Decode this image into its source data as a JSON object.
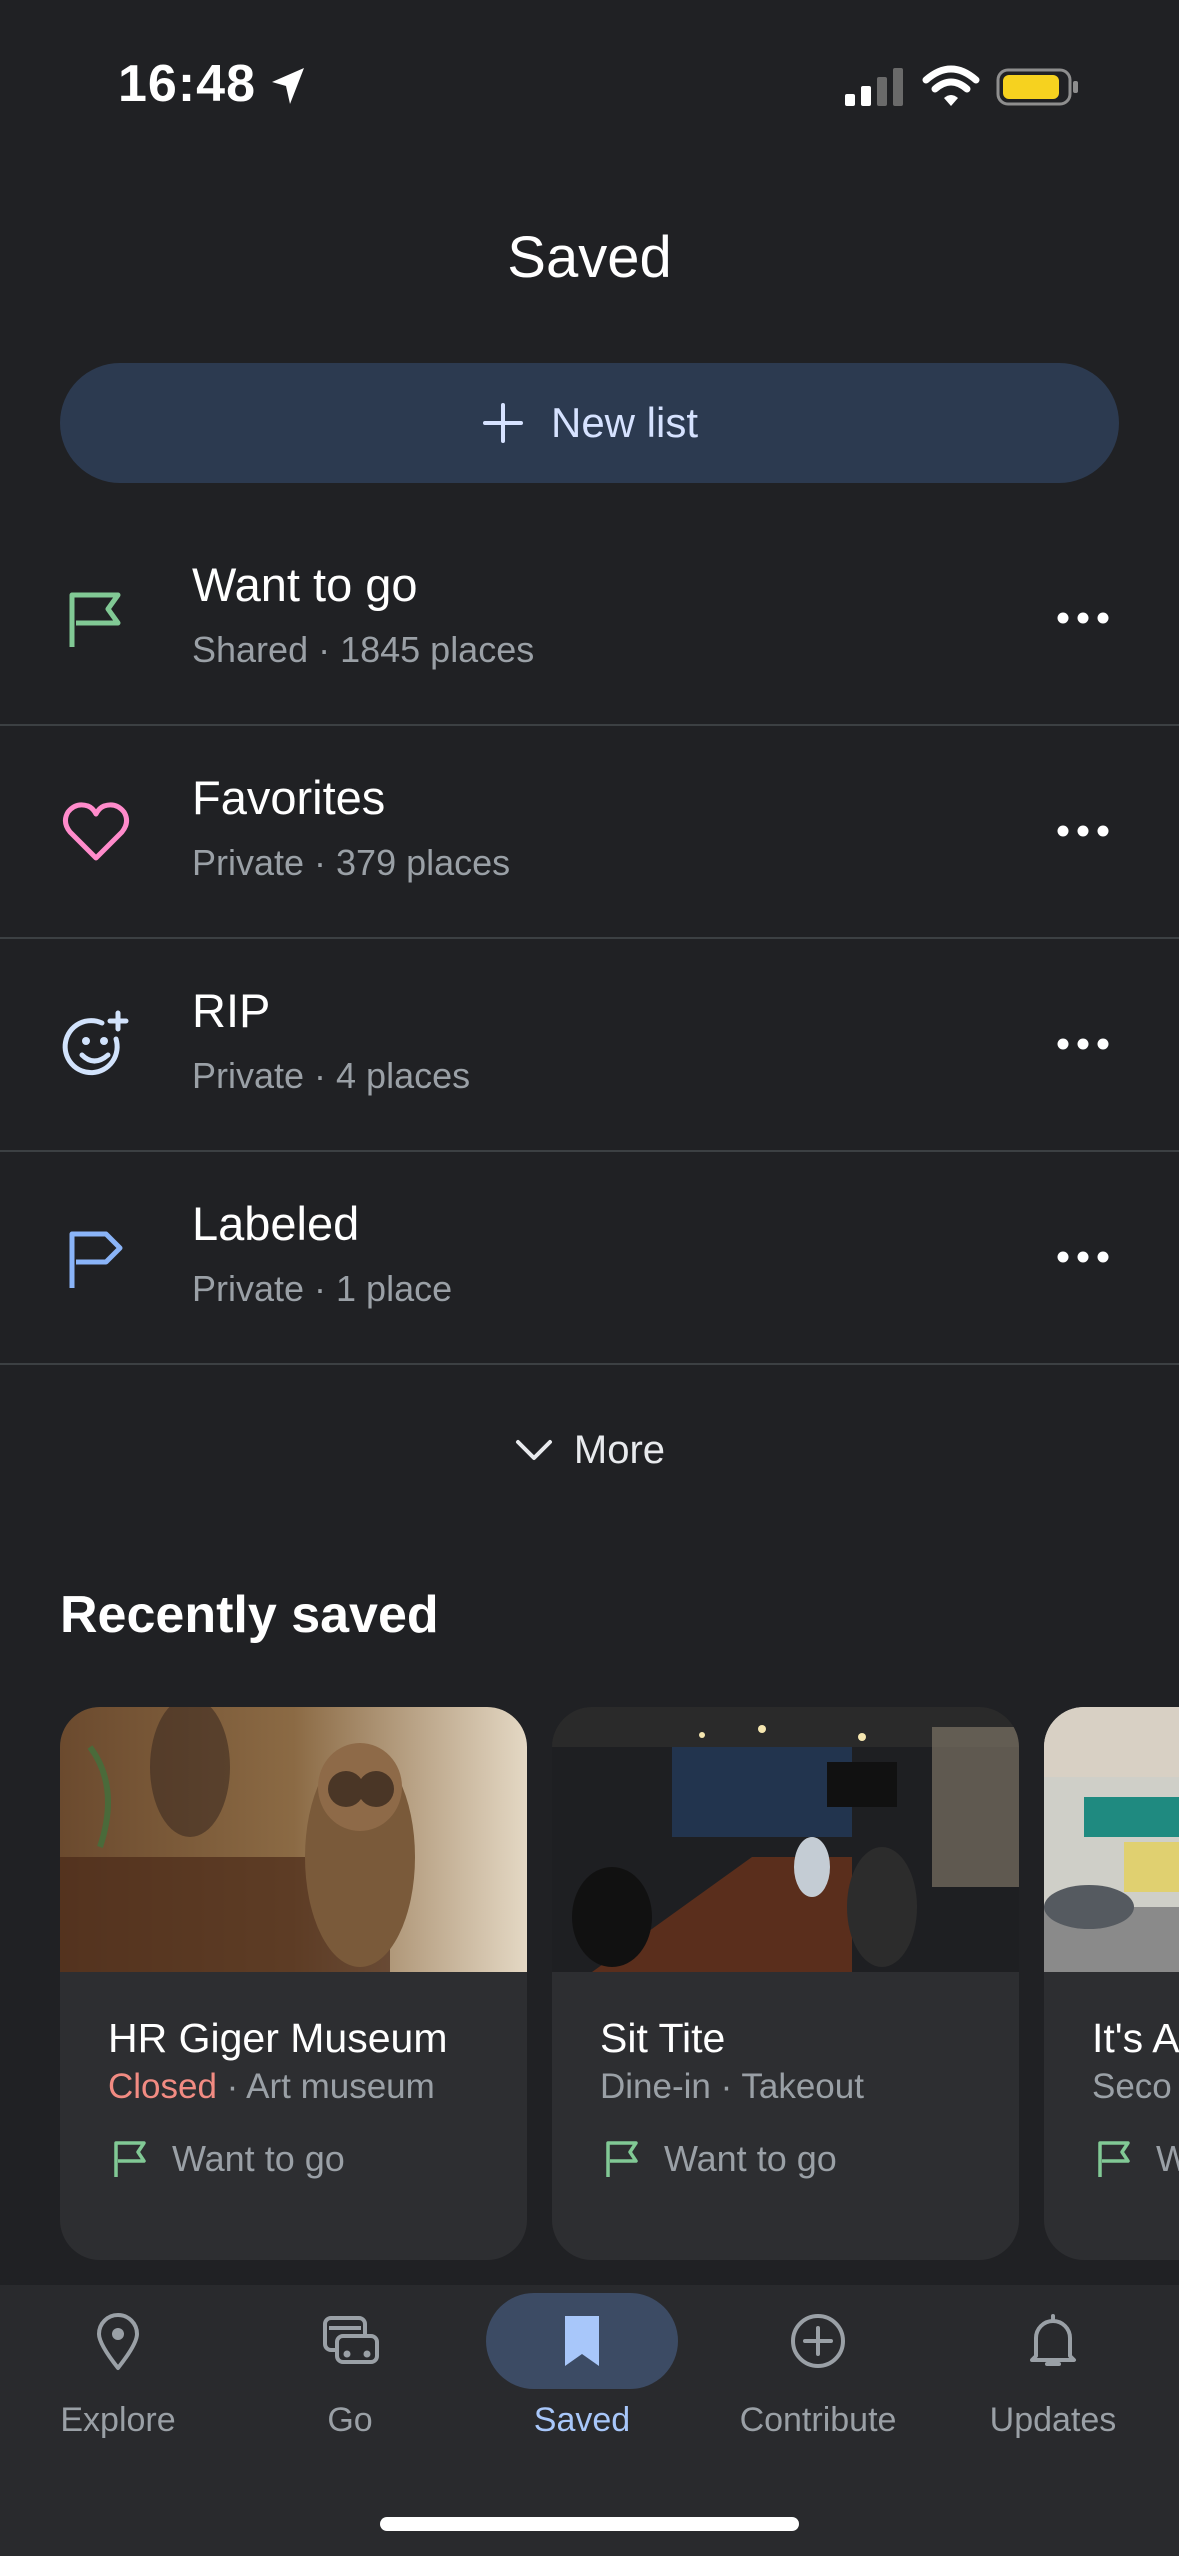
{
  "status_bar": {
    "time": "16:48"
  },
  "header": {
    "title": "Saved"
  },
  "new_list_button": {
    "label": "New list"
  },
  "lists": [
    {
      "title": "Want to go",
      "subtitle": "Shared · 1845 places",
      "icon": "flag-icon",
      "color": "#81c995"
    },
    {
      "title": "Favorites",
      "subtitle": "Private · 379 places",
      "icon": "heart-icon",
      "color": "#ff8bcb"
    },
    {
      "title": "RIP",
      "subtitle": "Private · 4 places",
      "icon": "smiley-plus-icon",
      "color": "#d2e3fc"
    },
    {
      "title": "Labeled",
      "subtitle": "Private · 1 place",
      "icon": "label-flag-icon",
      "color": "#8ab4f8"
    }
  ],
  "more_button": {
    "label": "More"
  },
  "recently_saved": {
    "title": "Recently saved",
    "cards": [
      {
        "title": "HR Giger Museum",
        "status": "Closed",
        "subtitle": " · Art museum",
        "list": "Want to go"
      },
      {
        "title": "Sit Tite",
        "status": "",
        "subtitle": "Dine-in · Takeout",
        "list": "Want to go"
      },
      {
        "title": "It's A",
        "status": "",
        "subtitle": "Seco",
        "list": "W"
      }
    ]
  },
  "bottom_nav": {
    "items": [
      {
        "label": "Explore",
        "icon": "location-pin-icon"
      },
      {
        "label": "Go",
        "icon": "car-icon"
      },
      {
        "label": "Saved",
        "icon": "bookmark-icon",
        "active": true
      },
      {
        "label": "Contribute",
        "icon": "add-circle-icon"
      },
      {
        "label": "Updates",
        "icon": "bell-icon"
      }
    ]
  },
  "colors": {
    "background": "#202124",
    "accent": "#a8c7fa",
    "closed": "#f28b82"
  }
}
